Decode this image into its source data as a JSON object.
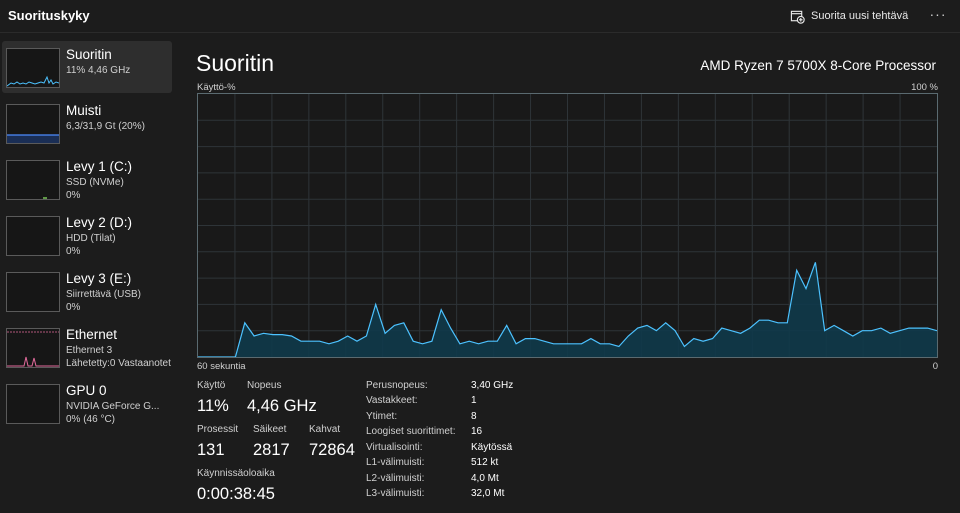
{
  "app": {
    "title": "Suorituskyky",
    "run_task_label": "Suorita uusi tehtävä",
    "more_label": "···"
  },
  "sidebar": {
    "items": [
      {
        "name": "Suoritin",
        "line1": "11% 4,46 GHz",
        "line2": "",
        "active": true,
        "color": "#4cc2ff"
      },
      {
        "name": "Muisti",
        "line1": "6,3/31,9 Gt (20%)",
        "line2": "",
        "active": false,
        "color": "#4c8cff"
      },
      {
        "name": "Levy 1 (C:)",
        "line1": "SSD (NVMe)",
        "line2": "0%",
        "active": false,
        "color": "#7fd05c"
      },
      {
        "name": "Levy 2 (D:)",
        "line1": "HDD (Tilat)",
        "line2": "0%",
        "active": false,
        "color": "#7fd05c"
      },
      {
        "name": "Levy 3 (E:)",
        "line1": "Siirrettävä (USB)",
        "line2": "0%",
        "active": false,
        "color": "#7fd05c"
      },
      {
        "name": "Ethernet",
        "line1": "Ethernet 3",
        "line2": "Lähetetty:0 Vastaanotet",
        "active": false,
        "color": "#e36b9c"
      },
      {
        "name": "GPU 0",
        "line1": "NVIDIA GeForce G...",
        "line2": "0% (46 °C)",
        "active": false,
        "color": "#4cc2ff"
      }
    ]
  },
  "main": {
    "title": "Suoritin",
    "processor": "AMD Ryzen 7 5700X 8-Core Processor",
    "graph": {
      "y_label": "Käyttö-%",
      "y_max_label": "100 %",
      "x_left_label": "60 sekuntia",
      "x_right_label": "0",
      "line_color": "#4cc2ff",
      "fill_color": "#0f3a4a",
      "usage_percent": [
        0,
        0,
        0,
        0,
        0,
        13,
        8,
        9,
        8.5,
        8.5,
        8,
        6,
        6,
        6,
        5,
        6,
        8,
        6,
        8,
        20,
        9,
        12,
        13,
        6,
        5,
        6,
        18,
        11,
        5,
        6,
        5,
        6,
        6,
        12,
        5,
        7,
        7,
        6,
        5,
        5,
        5,
        5,
        7,
        5,
        5,
        4,
        8,
        11,
        12,
        10,
        13,
        10,
        4,
        7,
        6,
        7,
        11,
        10,
        9,
        11,
        14,
        14,
        13,
        13,
        33,
        26,
        36,
        10,
        12,
        10,
        8,
        10,
        10,
        11,
        9,
        10,
        11,
        11,
        11,
        10
      ]
    },
    "stats": {
      "usage_label": "Käyttö",
      "usage_value": "11%",
      "speed_label": "Nopeus",
      "speed_value": "4,46 GHz",
      "processes_label": "Prosessit",
      "processes_value": "131",
      "threads_label": "Säikeet",
      "threads_value": "2817",
      "handles_label": "Kahvat",
      "handles_value": "72864",
      "uptime_label": "Käynnissäoloaika",
      "uptime_value": "0:00:38:45"
    },
    "specs": [
      {
        "key": "Perusnopeus:",
        "value": "3,40 GHz"
      },
      {
        "key": "Vastakkeet:",
        "value": "1"
      },
      {
        "key": "Ytimet:",
        "value": "8"
      },
      {
        "key": "Loogiset suorittimet:",
        "value": "16"
      },
      {
        "key": "Virtualisointi:",
        "value": "Käytössä"
      },
      {
        "key": "L1-välimuisti:",
        "value": "512 kt"
      },
      {
        "key": "L2-välimuisti:",
        "value": "4,0 Mt"
      },
      {
        "key": "L3-välimuisti:",
        "value": "32,0 Mt"
      }
    ]
  }
}
